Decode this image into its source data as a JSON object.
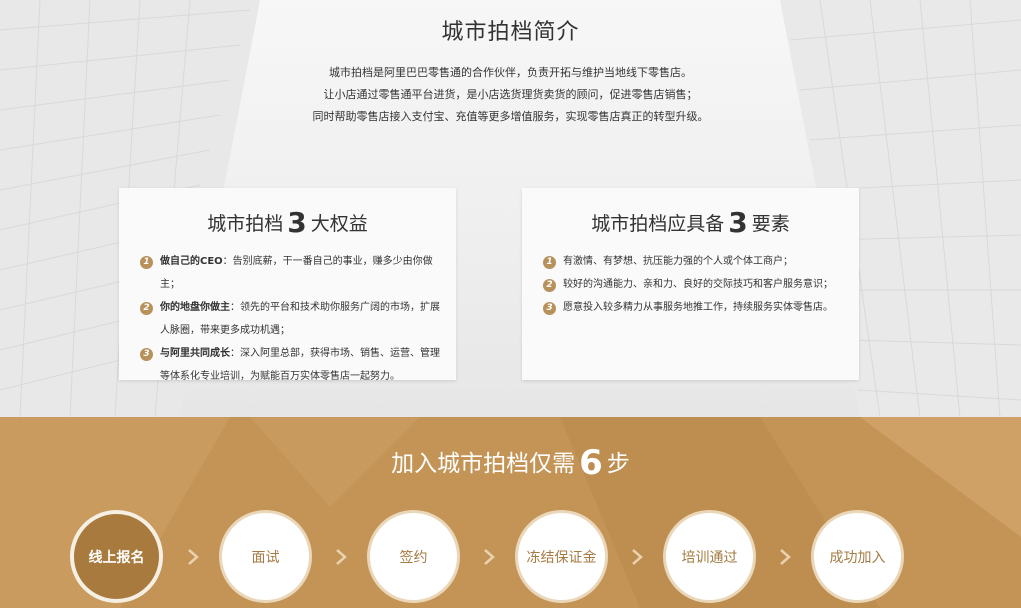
{
  "intro": {
    "title": "城市拍档简介",
    "lines": [
      "城市拍档是阿里巴巴零售通的合作伙伴，负责开拓与维护当地线下零售店。",
      "让小店通过零售通平台进货，是小店选货理货卖货的顾问，促进零售店销售；",
      "同时帮助零售店接入支付宝、充值等更多增值服务，实现零售店真正的转型升级。"
    ]
  },
  "benefits": {
    "title_pre": "城市拍档",
    "title_num": "3",
    "title_post": "大权益",
    "items": [
      {
        "num": "1",
        "bold": "做自己的CEO",
        "text": "：告别底薪，干一番自己的事业，赚多少由你做主；"
      },
      {
        "num": "2",
        "bold": "你的地盘你做主",
        "text": "：领先的平台和技术助你服务广阔的市场，扩展人脉圈，带来更多成功机遇；"
      },
      {
        "num": "3",
        "bold": "与阿里共同成长",
        "text": "：深入阿里总部，获得市场、销售、运营、管理等体系化专业培训，为赋能百万实体零售店一起努力。"
      }
    ]
  },
  "requirements": {
    "title_pre": "城市拍档应具备",
    "title_num": "3",
    "title_post": "要素",
    "items": [
      {
        "num": "1",
        "text": "有激情、有梦想、抗压能力强的个人或个体工商户；"
      },
      {
        "num": "2",
        "text": "较好的沟通能力、亲和力、良好的交际技巧和客户服务意识；"
      },
      {
        "num": "3",
        "text": "愿意投入较多精力从事服务地推工作，持续服务实体零售店。"
      }
    ]
  },
  "join": {
    "title_pre": "加入城市拍档仅需",
    "title_num": "6",
    "title_post": "步",
    "steps": [
      "线上报名",
      "面试",
      "签约",
      "冻结保证金",
      "培训通过",
      "成功加入"
    ]
  },
  "colors": {
    "accent": "#b8905a",
    "band": "#c39456",
    "active_step": "#a87a3e",
    "step_text": "#a57b43"
  }
}
